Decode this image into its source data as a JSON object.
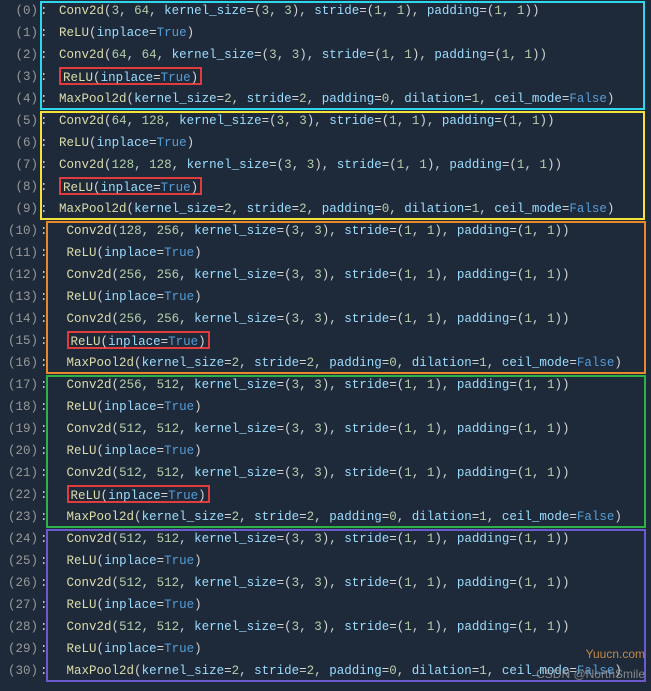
{
  "watermarks": {
    "top": "Yuucn.com",
    "bottom": "CSDN @NorthSmile"
  },
  "lines": [
    {
      "idx": 0,
      "indent": 1,
      "type": "conv",
      "in": 3,
      "out": 64,
      "k": "(3, 3)",
      "s": "(1, 1)",
      "p": "(1, 1)"
    },
    {
      "idx": 1,
      "indent": 1,
      "type": "relu"
    },
    {
      "idx": 2,
      "indent": 1,
      "type": "conv",
      "in": 64,
      "out": 64,
      "k": "(3, 3)",
      "s": "(1, 1)",
      "p": "(1, 1)"
    },
    {
      "idx": 3,
      "indent": 1,
      "type": "relu",
      "box": true
    },
    {
      "idx": 4,
      "indent": 1,
      "type": "pool"
    },
    {
      "idx": 5,
      "indent": 1,
      "type": "conv",
      "in": 64,
      "out": 128,
      "k": "(3, 3)",
      "s": "(1, 1)",
      "p": "(1, 1)"
    },
    {
      "idx": 6,
      "indent": 1,
      "type": "relu"
    },
    {
      "idx": 7,
      "indent": 1,
      "type": "conv",
      "in": 128,
      "out": 128,
      "k": "(3, 3)",
      "s": "(1, 1)",
      "p": "(1, 1)"
    },
    {
      "idx": 8,
      "indent": 1,
      "type": "relu",
      "box": true
    },
    {
      "idx": 9,
      "indent": 1,
      "type": "pool"
    },
    {
      "idx": 10,
      "indent": 2,
      "type": "conv",
      "in": 128,
      "out": 256,
      "k": "(3, 3)",
      "s": "(1, 1)",
      "p": "(1, 1)"
    },
    {
      "idx": 11,
      "indent": 2,
      "type": "relu"
    },
    {
      "idx": 12,
      "indent": 2,
      "type": "conv",
      "in": 256,
      "out": 256,
      "k": "(3, 3)",
      "s": "(1, 1)",
      "p": "(1, 1)"
    },
    {
      "idx": 13,
      "indent": 2,
      "type": "relu"
    },
    {
      "idx": 14,
      "indent": 2,
      "type": "conv",
      "in": 256,
      "out": 256,
      "k": "(3, 3)",
      "s": "(1, 1)",
      "p": "(1, 1)"
    },
    {
      "idx": 15,
      "indent": 2,
      "type": "relu",
      "box": true
    },
    {
      "idx": 16,
      "indent": 2,
      "type": "pool"
    },
    {
      "idx": 17,
      "indent": 2,
      "type": "conv",
      "in": 256,
      "out": 512,
      "k": "(3, 3)",
      "s": "(1, 1)",
      "p": "(1, 1)"
    },
    {
      "idx": 18,
      "indent": 2,
      "type": "relu"
    },
    {
      "idx": 19,
      "indent": 2,
      "type": "conv",
      "in": 512,
      "out": 512,
      "k": "(3, 3)",
      "s": "(1, 1)",
      "p": "(1, 1)"
    },
    {
      "idx": 20,
      "indent": 2,
      "type": "relu"
    },
    {
      "idx": 21,
      "indent": 2,
      "type": "conv",
      "in": 512,
      "out": 512,
      "k": "(3, 3)",
      "s": "(1, 1)",
      "p": "(1, 1)"
    },
    {
      "idx": 22,
      "indent": 2,
      "type": "relu",
      "box": true
    },
    {
      "idx": 23,
      "indent": 2,
      "type": "pool"
    },
    {
      "idx": 24,
      "indent": 2,
      "type": "conv",
      "in": 512,
      "out": 512,
      "k": "(3, 3)",
      "s": "(1, 1)",
      "p": "(1, 1)"
    },
    {
      "idx": 25,
      "indent": 2,
      "type": "relu"
    },
    {
      "idx": 26,
      "indent": 2,
      "type": "conv",
      "in": 512,
      "out": 512,
      "k": "(3, 3)",
      "s": "(1, 1)",
      "p": "(1, 1)"
    },
    {
      "idx": 27,
      "indent": 2,
      "type": "relu"
    },
    {
      "idx": 28,
      "indent": 2,
      "type": "conv",
      "in": 512,
      "out": 512,
      "k": "(3, 3)",
      "s": "(1, 1)",
      "p": "(1, 1)"
    },
    {
      "idx": 29,
      "indent": 2,
      "type": "relu"
    },
    {
      "idx": 30,
      "indent": 2,
      "type": "pool"
    }
  ],
  "labels": {
    "conv": "Conv2d",
    "relu": "ReLU",
    "pool": "MaxPool2d",
    "kernel": "kernel_size",
    "stride": "stride",
    "padding": "padding",
    "dilation": "dilation",
    "ceil_mode": "ceil_mode",
    "inplace": "inplace",
    "true": "True",
    "false": "False"
  },
  "pool_args": {
    "k": 2,
    "s": 2,
    "p": 0,
    "d": 1
  }
}
